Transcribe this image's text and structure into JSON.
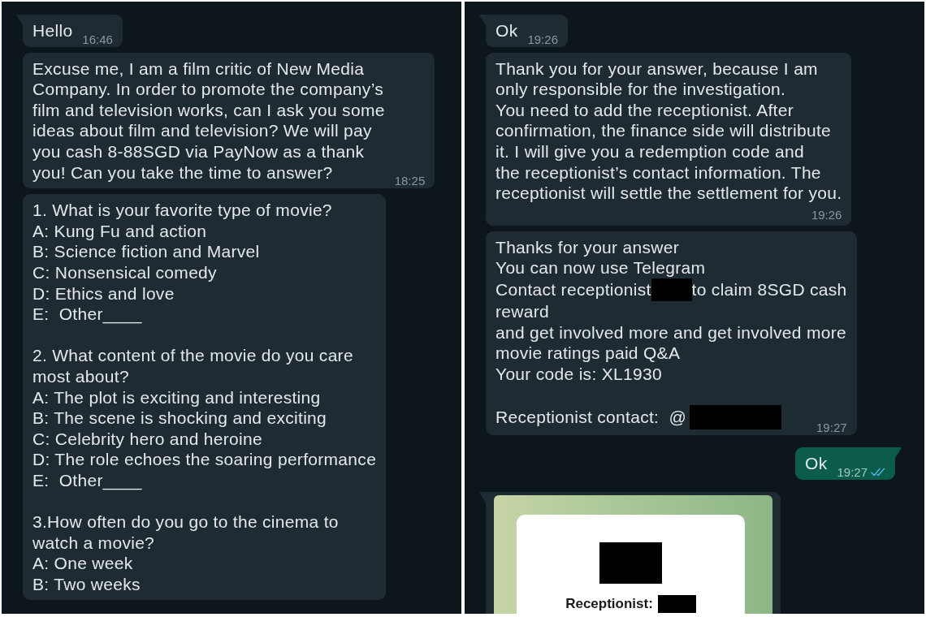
{
  "panels": [
    {
      "messages": [
        {
          "kind": "incoming",
          "tail": true,
          "body": [
            {
              "kind": "text",
              "text": "Hello"
            }
          ],
          "time": "16:46"
        },
        {
          "kind": "incoming",
          "tail": false,
          "body": [
            {
              "kind": "text",
              "text": "Excuse me, I am a film critic of New Media\nCompany. In order to promote the company’s\nfilm and television works, can I ask you some\nideas about film and television? We will pay\nyou cash 8-88SGD via PayNow as a thank\nyou! Can you take the time to answer?"
            }
          ],
          "time": "18:25"
        },
        {
          "kind": "incoming",
          "tail": false,
          "body": [
            {
              "kind": "text",
              "text": "1. What is your favorite type of movie?\nA: Kung Fu and action\nB: Science fiction and Marvel\nC: Nonsensical comedy\nD: Ethics and love\nE:  Other____"
            },
            {
              "kind": "blank"
            },
            {
              "kind": "text",
              "text": "2. What content of the movie do you care\nmost about?\nA: The plot is exciting and interesting\nB: The scene is shocking and exciting\nC: Celebrity hero and heroine\nD: The role echoes the soaring performance\nE:  Other____"
            },
            {
              "kind": "blank"
            },
            {
              "kind": "text",
              "text": "3.How often do you go to the cinema to\nwatch a movie?\nA: One week\nB: Two weeks"
            }
          ]
        }
      ]
    },
    {
      "messages": [
        {
          "kind": "incoming",
          "tail": true,
          "body": [
            {
              "kind": "text",
              "text": "Ok"
            }
          ],
          "time": "19:26"
        },
        {
          "kind": "incoming",
          "tail": false,
          "body": [
            {
              "kind": "text",
              "text": "Thank you for your answer, because I am\nonly responsible for the investigation.\nYou need to add the receptionist. After\nconfirmation, the finance side will distribute\nit. I will give you a redemption code and\nthe receptionist’s contact information. The\nreceptionist will settle the settlement for you."
            }
          ],
          "time": "19:26"
        },
        {
          "kind": "incoming",
          "tail": false,
          "body": [
            {
              "kind": "text",
              "text": "Thanks for your answer\nYou can now use Telegram"
            },
            {
              "kind": "row",
              "parts": [
                {
                  "kind": "text",
                  "text": "Contact receptionist"
                },
                {
                  "kind": "redacted"
                },
                {
                  "kind": "text",
                  "text": "to claim 8SGD cash"
                }
              ]
            },
            {
              "kind": "text",
              "text": "reward\nand get involved more and get involved more\nmovie ratings paid Q&A\nYour code is: XL1930"
            },
            {
              "kind": "blank"
            },
            {
              "kind": "row",
              "parts": [
                {
                  "kind": "text",
                  "text": "Receptionist contact:  @"
                },
                {
                  "kind": "redacted"
                }
              ]
            }
          ],
          "time": "19:27"
        },
        {
          "kind": "outgoing",
          "tail": true,
          "body": [
            {
              "kind": "text",
              "text": "Ok"
            }
          ],
          "time": "19:27",
          "read": true
        },
        {
          "kind": "incoming",
          "tail": true,
          "body": [
            {
              "kind": "image",
              "label": "Receptionist:"
            }
          ]
        }
      ]
    }
  ]
}
